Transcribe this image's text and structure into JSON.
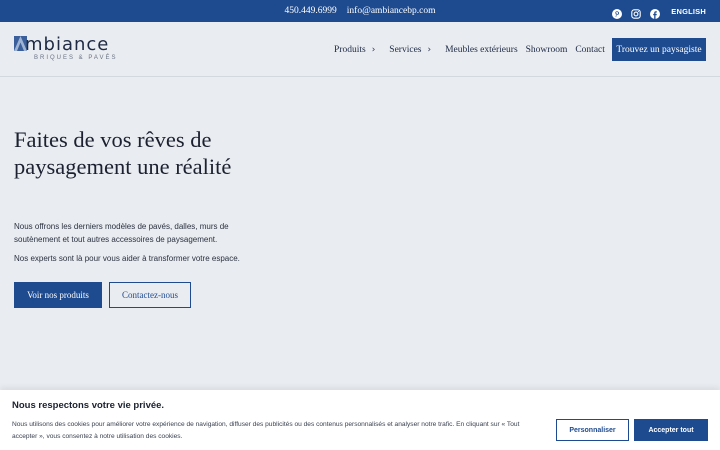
{
  "topbar": {
    "phone": "450.449.6999",
    "email": "info@ambiancebp.com",
    "social": [
      "pinterest-icon",
      "instagram-icon",
      "facebook-icon"
    ],
    "language": "ENGLISH"
  },
  "logo": {
    "name": "Ambiance",
    "name_rest": "mbiance",
    "tagline": "BRIQUES & PAVÉS"
  },
  "nav": {
    "items": [
      {
        "label": "Produits",
        "has_submenu": true
      },
      {
        "label": "Services",
        "has_submenu": true
      },
      {
        "label": "Meubles extérieurs",
        "has_submenu": false
      },
      {
        "label": "Showroom",
        "has_submenu": false
      },
      {
        "label": "Contact",
        "has_submenu": false
      }
    ],
    "cta": "Trouvez un paysagiste"
  },
  "hero": {
    "title": "Faites de vos rêves de paysagement une réalité",
    "paragraph1": "Nous offrons les derniers modèles de pavés, dalles, murs de soutènement et tout autres accessoires de paysagement.",
    "paragraph2": "Nos experts sont là pour vous aider à transformer votre espace.",
    "primary_button": "Voir nos produits",
    "secondary_button": "Contactez-nous"
  },
  "cookie": {
    "title": "Nous respectons votre vie privée.",
    "text": "Nous utilisons des cookies pour améliorer votre expérience de navigation, diffuser des publicités ou des contenus personnalisés et analyser notre trafic. En cliquant sur « Tout accepter », vous consentez à notre utilisation des cookies.",
    "customize_button": "Personnaliser",
    "accept_button": "Accepter tout"
  },
  "colors": {
    "brand_blue": "#1e4b8f",
    "background": "#e9ecf0",
    "text_dark": "#1b2130"
  }
}
